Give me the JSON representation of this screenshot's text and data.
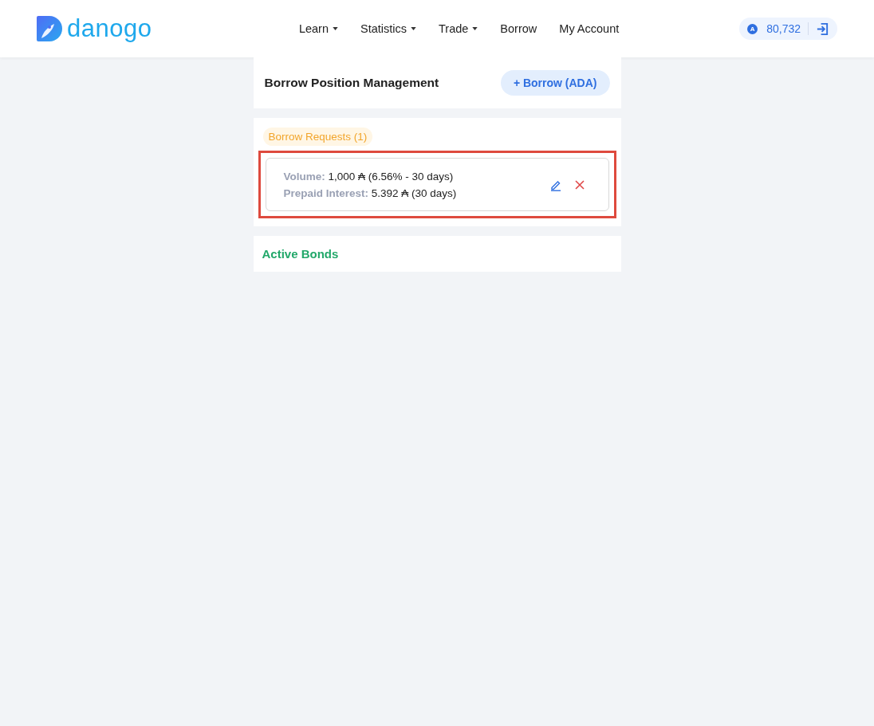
{
  "header": {
    "logo": "danogo",
    "nav": [
      {
        "label": "Learn",
        "dropdown": true
      },
      {
        "label": "Statistics",
        "dropdown": true
      },
      {
        "label": "Trade",
        "dropdown": true
      },
      {
        "label": "Borrow",
        "dropdown": false
      },
      {
        "label": "My Account",
        "dropdown": false
      }
    ],
    "wallet": {
      "coin": "A",
      "balance": "80,732"
    }
  },
  "position": {
    "title": "Borrow Position Management",
    "button": "+ Borrow (ADA)"
  },
  "requests": {
    "tab": "Borrow Requests (1)",
    "items": [
      {
        "highlighted": true,
        "lines": [
          {
            "label": "Volume:",
            "value": "1,000 ₳ (6.56% - 30 days)"
          },
          {
            "label": "Prepaid Interest:",
            "value": "5.392 ₳ (30 days)"
          }
        ]
      }
    ]
  },
  "bonds": {
    "title": "Active Bonds"
  }
}
